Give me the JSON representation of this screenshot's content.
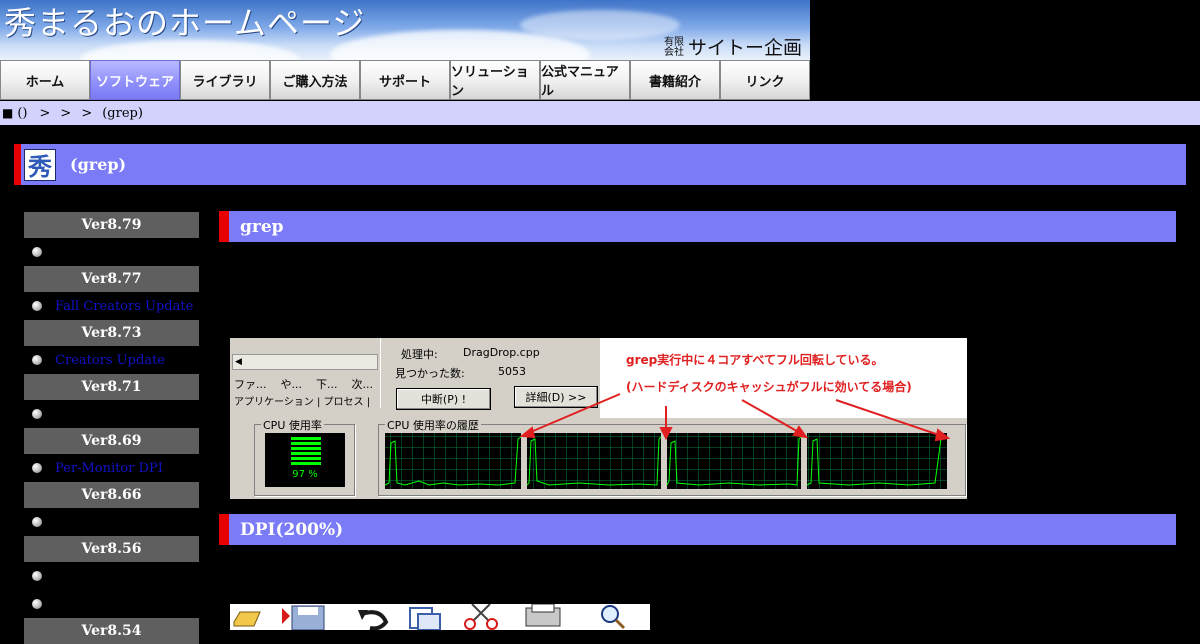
{
  "banner": {
    "site_title": "秀まるおのホームページ",
    "company_small_top": "有限",
    "company_small_bottom": "会社",
    "company_name": "サイトー企画"
  },
  "nav": {
    "items": [
      {
        "label": "ホーム",
        "active": false
      },
      {
        "label": "ソフトウェア",
        "active": true
      },
      {
        "label": "ライブラリ",
        "active": false
      },
      {
        "label": "ご購入方法",
        "active": false
      },
      {
        "label": "サポート",
        "active": false
      },
      {
        "label": "ソリューション",
        "active": false
      },
      {
        "label": "公式マニュアル",
        "active": false
      },
      {
        "label": "書籍紹介",
        "active": false
      },
      {
        "label": "リンク",
        "active": false
      }
    ]
  },
  "breadcrumb": {
    "marker": "■",
    "first": "()",
    "sep": ">",
    "last": "(grep)"
  },
  "page": {
    "title": "(grep)",
    "logo_glyph": "秀"
  },
  "sidebar": {
    "versions": [
      {
        "label": "Ver8.79",
        "items": [
          ""
        ]
      },
      {
        "label": "Ver8.77",
        "items": [
          "Fall Creators Update"
        ]
      },
      {
        "label": "Ver8.73",
        "items": [
          "Creators Update"
        ]
      },
      {
        "label": "Ver8.71",
        "items": [
          ""
        ]
      },
      {
        "label": "Ver8.69",
        "items": [
          "Per-Monitor DPI"
        ]
      },
      {
        "label": "Ver8.66",
        "items": [
          ""
        ]
      },
      {
        "label": "Ver8.56",
        "items": [
          "",
          ""
        ]
      },
      {
        "label": "Ver8.54",
        "items": []
      }
    ]
  },
  "sections": {
    "grep_header": "grep",
    "dpi_header": "DPI(200%)"
  },
  "screenshot": {
    "menu": [
      "ファ...",
      "や...",
      "下...",
      "次..."
    ],
    "tabs_text": "アプリケーション | プロセス |",
    "processing_label": "処理中:",
    "processing_value": "DragDrop.cpp",
    "found_label": "見つかった数:",
    "found_value": "5053",
    "stop_button": "中断(P) !",
    "detail_button": "詳細(D) >>",
    "note_line1": "grep実行中に４コアすべてフル回転している。",
    "note_line2": "(ハードディスクのキャッシュがフルに効いてる場合)",
    "cpu_usage_label": "CPU 使用率",
    "cpu_usage_value": "97 %",
    "cpu_history_label": "CPU 使用率の履歴",
    "colors": {
      "graph_line": "#00ff00",
      "graph_grid": "#008040",
      "note_text": "#e02020"
    }
  }
}
